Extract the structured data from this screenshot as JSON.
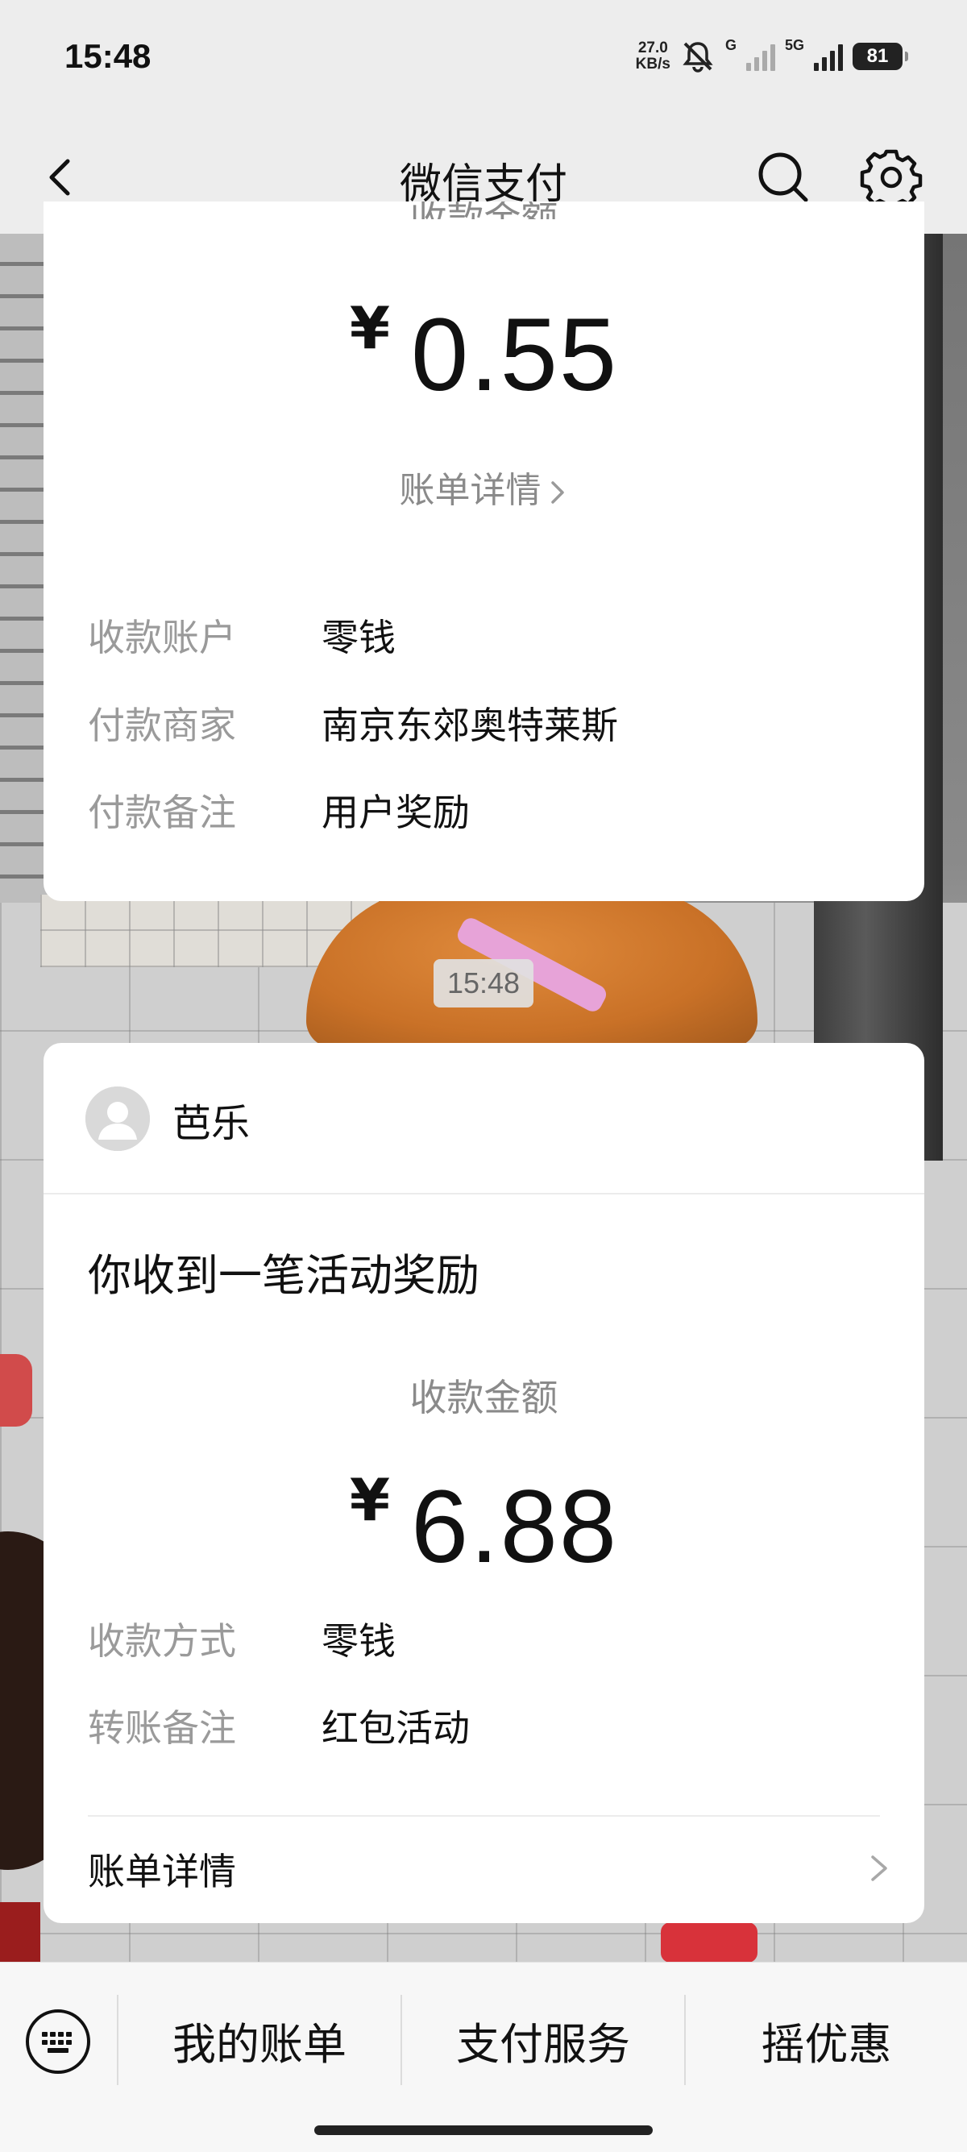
{
  "status_bar": {
    "time": "15:48",
    "net_speed_value": "27.0",
    "net_speed_unit": "KB/s",
    "sim1_label": "G",
    "sim2_label": "5G",
    "battery": "81"
  },
  "nav": {
    "title": "微信支付",
    "icons": [
      "back-icon",
      "search-icon",
      "gear-icon"
    ]
  },
  "card1": {
    "cut_label": "收款金额",
    "currency": "¥",
    "amount": "0.55",
    "bill_link": "账单详情",
    "rows": [
      {
        "key": "收款账户",
        "value": "零钱"
      },
      {
        "key": "付款商家",
        "value": "南京东郊奥特莱斯"
      },
      {
        "key": "付款备注",
        "value": "用户奖励"
      }
    ]
  },
  "timestamp": "15:48",
  "card2": {
    "sender": "芭乐",
    "title": "你收到一笔活动奖励",
    "amount_label": "收款金额",
    "currency": "¥",
    "amount": "6.88",
    "rows": [
      {
        "key": "收款方式",
        "value": "零钱"
      },
      {
        "key": "转账备注",
        "value": "红包活动"
      }
    ],
    "bill_link": "账单详情"
  },
  "bottom_menu": {
    "items": [
      "我的账单",
      "支付服务",
      "摇优惠"
    ],
    "keyboard_icon": "keyboard-icon"
  }
}
